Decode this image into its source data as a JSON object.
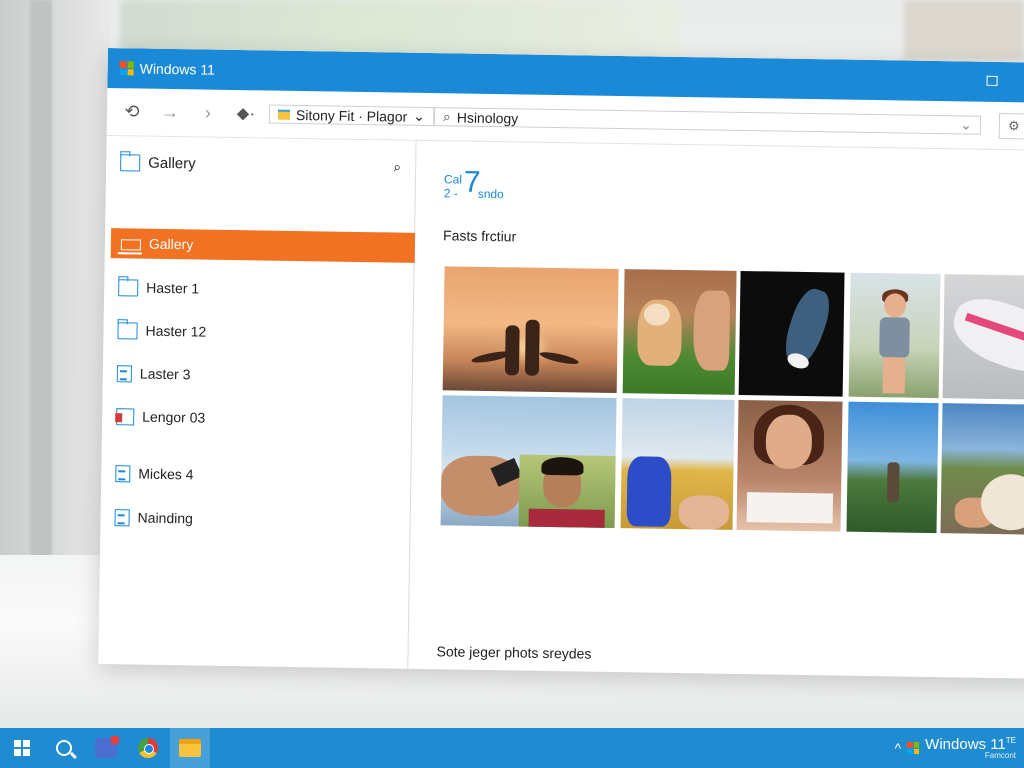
{
  "window": {
    "title": "Windows 11"
  },
  "toolbar": {
    "back_icon": "back-icon",
    "forward_icon": "forward-icon",
    "path": "Sitony Fit · Plagor",
    "search_value": "Hsinology",
    "settings_icon": "settings-icon"
  },
  "sidebar": {
    "header": "Gallery",
    "items": [
      {
        "label": "Gallery",
        "icon": "laptop-icon",
        "active": true
      },
      {
        "label": "Haster 1",
        "icon": "folder-icon"
      },
      {
        "label": "Haster 12",
        "icon": "monitor-icon"
      },
      {
        "label": "Laster 3",
        "icon": "document-icon"
      },
      {
        "label": "Lengor 03",
        "icon": "document-icon"
      },
      {
        "label": "Mickes 4",
        "icon": "file-icon"
      },
      {
        "label": "Nainding",
        "icon": "file-icon"
      }
    ]
  },
  "main": {
    "count_small": "Cal",
    "count_big": "7",
    "count_prefix": "2 -",
    "count_suffix": "sndo",
    "section_title": "Fasts frctiur",
    "footer_text": "Sote jeger phots sreydes"
  },
  "taskbar": {
    "brand": "Windows 11",
    "brand_sup": "TE",
    "sub": "Famcont"
  },
  "colors": {
    "accent": "#1a8ad8",
    "active_item": "#f07222",
    "taskbar": "#1f8bd0"
  }
}
